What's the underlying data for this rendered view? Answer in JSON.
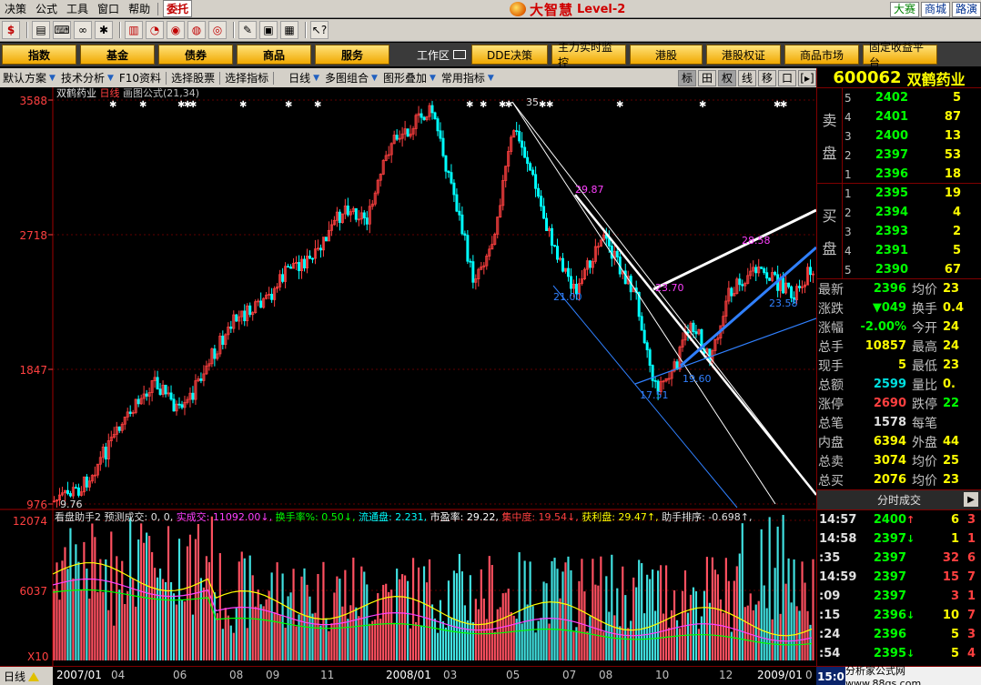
{
  "menubar": {
    "menus": [
      "决策",
      "公式",
      "工具",
      "窗口",
      "帮助"
    ],
    "trade": "委托"
  },
  "brand": {
    "name": "大智慧",
    "level": "Level-2"
  },
  "sys": {
    "dasai": "大赛",
    "shangcheng": "商城",
    "lujing": "路演"
  },
  "funcbar": {
    "tabs": [
      "指数",
      "基金",
      "债券",
      "商品",
      "服务"
    ],
    "workspace": "工作区",
    "links": [
      "DDE决策",
      "主力实时监控",
      "港股",
      "港股权证",
      "商品市场",
      "固定收益平台"
    ]
  },
  "chartbar": {
    "items": [
      "默认方案",
      "技术分析",
      "F10资料",
      "选择股票",
      "选择指标",
      "日线",
      "多图组合",
      "图形叠加",
      "常用指标"
    ],
    "toggles": [
      "标",
      "田",
      "权",
      "线",
      "移",
      "口",
      "[▸]"
    ]
  },
  "stock": {
    "code": "600062",
    "name": "双鹤药业"
  },
  "sell_side": "卖盘",
  "buy_side": "买盘",
  "sell": [
    {
      "level": "5",
      "price": "2402",
      "vol": "5"
    },
    {
      "level": "4",
      "price": "2401",
      "vol": "87"
    },
    {
      "level": "3",
      "price": "2400",
      "vol": "13"
    },
    {
      "level": "2",
      "price": "2397",
      "vol": "53"
    },
    {
      "level": "1",
      "price": "2396",
      "vol": "18"
    }
  ],
  "buy": [
    {
      "level": "1",
      "price": "2395",
      "vol": "19"
    },
    {
      "level": "2",
      "price": "2394",
      "vol": "4"
    },
    {
      "level": "3",
      "price": "2393",
      "vol": "2"
    },
    {
      "level": "4",
      "price": "2391",
      "vol": "5"
    },
    {
      "level": "5",
      "price": "2390",
      "vol": "67"
    }
  ],
  "quote": [
    {
      "k": "最新",
      "v": "2396",
      "vc": "green",
      "k2": "均价",
      "v2": "23",
      "v2c": "yellow"
    },
    {
      "k": "涨跌",
      "v": "▼049",
      "vc": "green",
      "k2": "换手",
      "v2": "0.4",
      "v2c": "yellow"
    },
    {
      "k": "涨幅",
      "v": "-2.00%",
      "vc": "green",
      "k2": "今开",
      "v2": "24",
      "v2c": "yellow"
    },
    {
      "k": "总手",
      "v": "10857",
      "vc": "yellow",
      "k2": "最高",
      "v2": "24",
      "v2c": "yellow"
    },
    {
      "k": "现手",
      "v": "5",
      "vc": "yellow",
      "k2": "最低",
      "v2": "23",
      "v2c": "yellow"
    },
    {
      "k": "总额",
      "v": "2599",
      "vc": "cyan",
      "k2": "量比",
      "v2": "0.",
      "v2c": "yellow"
    },
    {
      "k": "涨停",
      "v": "2690",
      "vc": "red",
      "k2": "跌停",
      "v2": "22",
      "v2c": "green"
    },
    {
      "k": "总笔",
      "v": "1578",
      "vc": "white",
      "k2": "每笔",
      "v2": "",
      "v2c": "yellow"
    },
    {
      "k": "内盘",
      "v": "6394",
      "vc": "yellow",
      "k2": "外盘",
      "v2": "44",
      "v2c": "yellow"
    },
    {
      "k": "总卖",
      "v": "3074",
      "vc": "yellow",
      "k2": "均价",
      "v2": "25",
      "v2c": "yellow"
    },
    {
      "k": "总买",
      "v": "2076",
      "vc": "yellow",
      "k2": "均价",
      "v2": "23",
      "v2c": "yellow"
    }
  ],
  "ticks_title": "分时成交",
  "ticks": [
    {
      "t": "14:57",
      "p": "2400",
      "a": "↑",
      "ac": "red",
      "v": "6",
      "vc": "yellow",
      "b": "3"
    },
    {
      "t": "14:58",
      "p": "2397",
      "a": "↓",
      "ac": "green",
      "v": "1",
      "vc": "yellow",
      "b": "1"
    },
    {
      "t": ":35",
      "p": "2397",
      "a": "",
      "ac": "green",
      "v": "32",
      "vc": "red",
      "b": "6"
    },
    {
      "t": "14:59",
      "p": "2397",
      "a": "",
      "ac": "green",
      "v": "15",
      "vc": "red",
      "b": "7"
    },
    {
      "t": ":09",
      "p": "2397",
      "a": "",
      "ac": "green",
      "v": "3",
      "vc": "red",
      "b": "1"
    },
    {
      "t": ":15",
      "p": "2396",
      "a": "↓",
      "ac": "green",
      "v": "10",
      "vc": "yellow",
      "b": "7"
    },
    {
      "t": ":24",
      "p": "2396",
      "a": "",
      "ac": "green",
      "v": "5",
      "vc": "yellow",
      "b": "3"
    },
    {
      "t": ":54",
      "p": "2395",
      "a": "↓",
      "ac": "green",
      "v": "5",
      "vc": "yellow",
      "b": "4"
    }
  ],
  "chart": {
    "title_name": "双鹤药业",
    "title_period": "日线",
    "title_tool": "画图公式(21,34)",
    "price_axis": [
      "3588",
      "2718",
      "1847",
      "976"
    ],
    "vol_axis": [
      "12074",
      "6037",
      "X10"
    ],
    "annotations": [
      "35.",
      "29.87",
      "21.00",
      "23.70",
      "28.58",
      "23.58",
      "17.51",
      "19.60",
      "9.76"
    ],
    "indicator_name": "看盘助手2",
    "indicator": [
      {
        "label": "预测成交:",
        "value": "0, 0,",
        "color": "#e0e0e0"
      },
      {
        "label": "实成交:",
        "value": "11092.00↓,",
        "color": "#ff40ff"
      },
      {
        "label": "换手率%:",
        "value": "0.50↓,",
        "color": "#00ff00"
      },
      {
        "label": "流通盘:",
        "value": "2.231,",
        "color": "#00ffff"
      },
      {
        "label": "市盈率:",
        "value": "29.22,",
        "color": "#ffffff"
      },
      {
        "label": "集中度:",
        "value": "19.54↓,",
        "color": "#ff4040"
      },
      {
        "label": "获利盘:",
        "value": "29.47↑,",
        "color": "#ffff00"
      },
      {
        "label": "助手排序:",
        "value": "-0.698↑,",
        "color": "#e0e0e0"
      }
    ]
  },
  "timeaxis": {
    "period": "日线",
    "labels": [
      "2007/01",
      "04",
      "06",
      "08",
      "09",
      "11",
      "2008/01",
      "03",
      "05",
      "07",
      "08",
      "10",
      "12",
      "2009/01",
      "0"
    ],
    "clock": "15:0",
    "site": "分析家公式网www.88gs.com"
  },
  "colors": {
    "up": "#ff4040",
    "down": "#00ffff",
    "grid": "#800000",
    "bg": "#000000"
  }
}
